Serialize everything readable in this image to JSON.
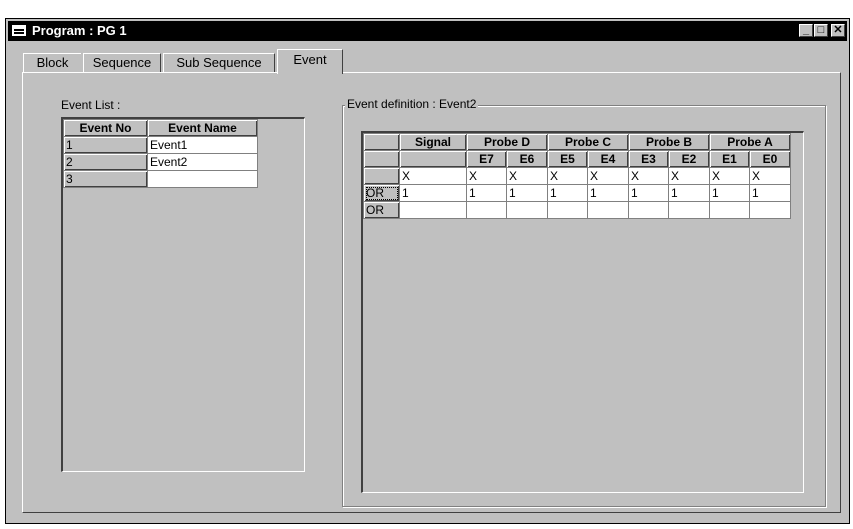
{
  "window": {
    "title": "Program : PG 1"
  },
  "tabs": [
    {
      "label": "Block"
    },
    {
      "label": "Sequence"
    },
    {
      "label": "Sub Sequence"
    },
    {
      "label": "Event"
    }
  ],
  "event_list": {
    "label": "Event List :",
    "columns": [
      "Event No",
      "Event Name"
    ],
    "rows": [
      {
        "no": "1",
        "name": "Event1"
      },
      {
        "no": "2",
        "name": "Event2"
      },
      {
        "no": "3",
        "name": ""
      }
    ]
  },
  "event_definition": {
    "label": "Event definition : Event2",
    "group_headers": [
      "Signal",
      "Probe D",
      "Probe C",
      "Probe B",
      "Probe A"
    ],
    "sub_headers": [
      "E7",
      "E6",
      "E5",
      "E4",
      "E3",
      "E2",
      "E1",
      "E0"
    ],
    "rows": [
      {
        "prefix": "",
        "signal": "X",
        "values": [
          "X",
          "X",
          "X",
          "X",
          "X",
          "X",
          "X",
          "X"
        ]
      },
      {
        "prefix": "OR",
        "signal": "1",
        "values": [
          "1",
          "1",
          "1",
          "1",
          "1",
          "1",
          "1",
          "1"
        ]
      },
      {
        "prefix": "OR",
        "signal": "",
        "values": [
          "",
          "",
          "",
          "",
          "",
          "",
          "",
          ""
        ]
      }
    ]
  }
}
